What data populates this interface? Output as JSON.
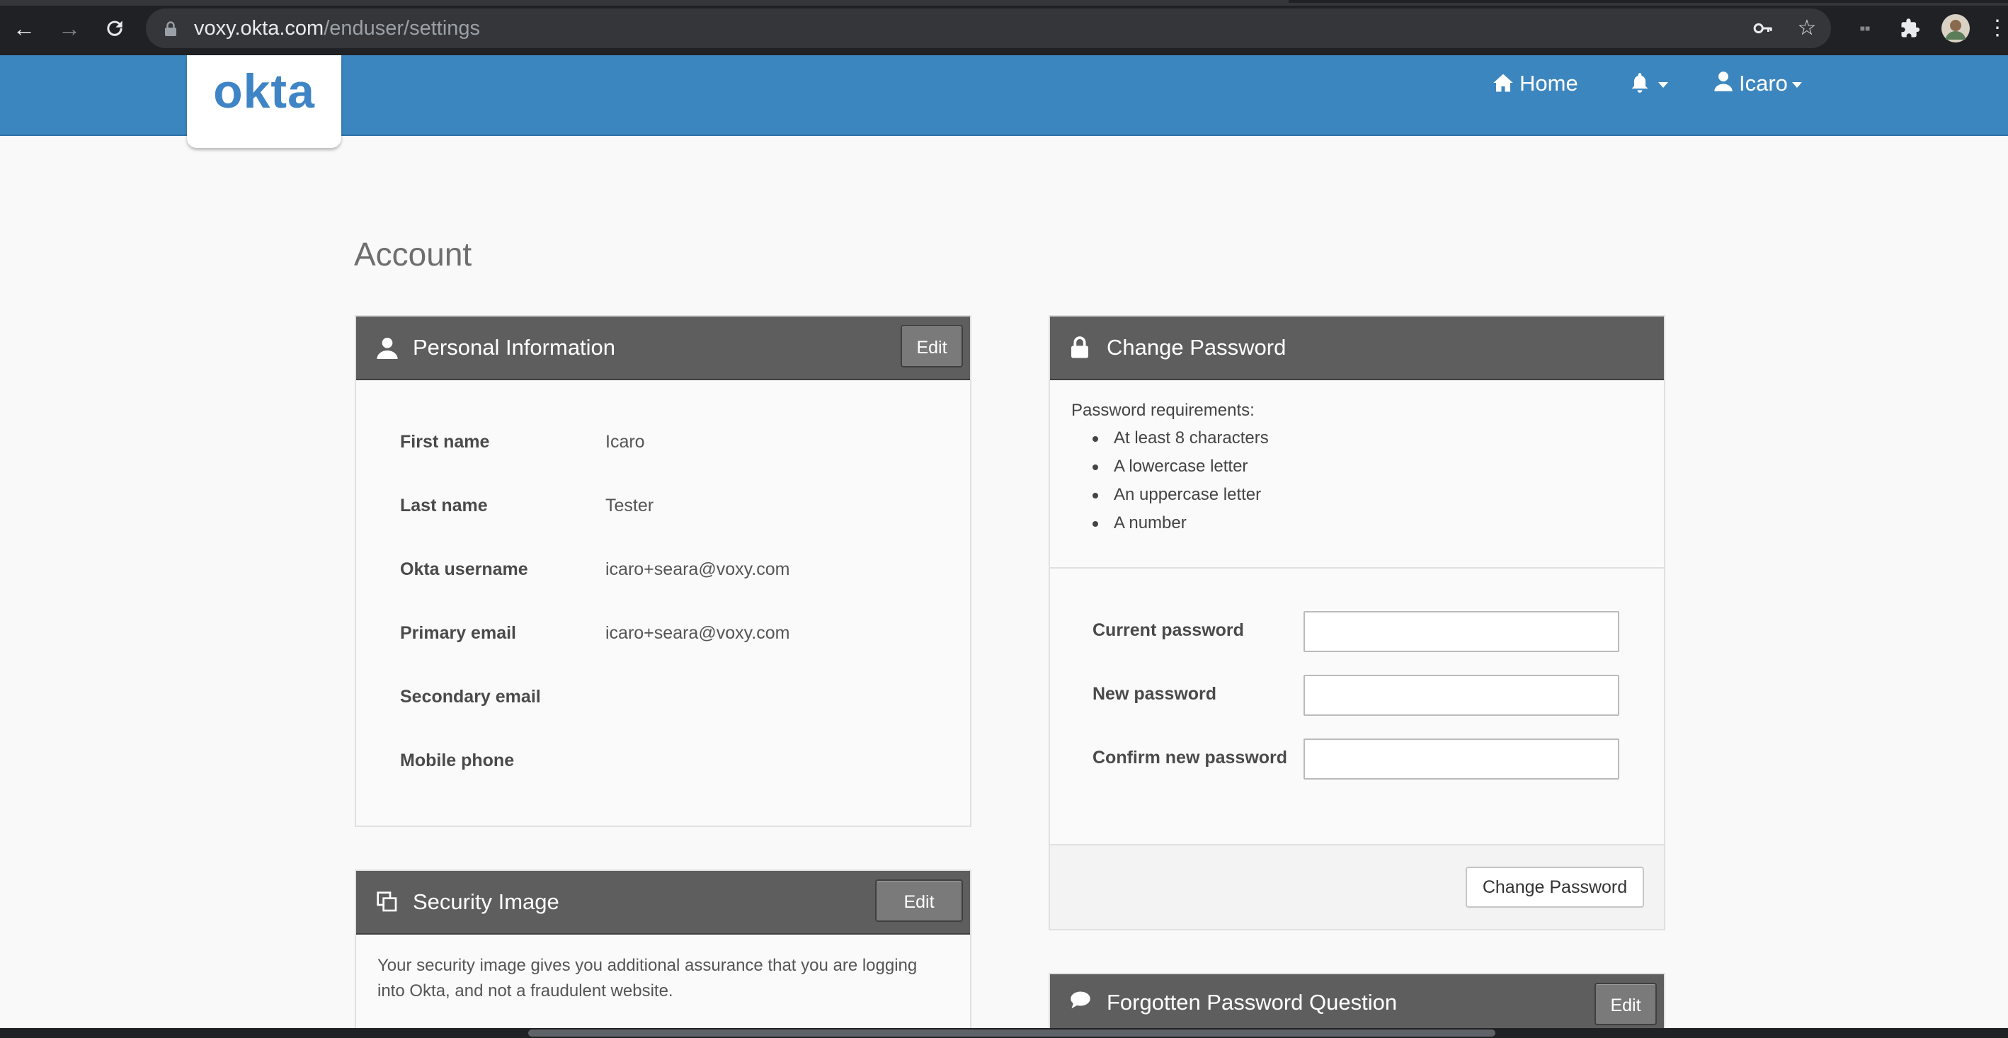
{
  "browser": {
    "url_domain": "voxy.okta.com",
    "url_path": "/enduser/settings"
  },
  "header": {
    "logo_text": "okta",
    "home_label": "Home",
    "user_label": "Icaro",
    "brand_color": "#3c86bf"
  },
  "page": {
    "title": "Account"
  },
  "personal_info": {
    "title": "Personal Information",
    "edit_label": "Edit",
    "fields": [
      {
        "label": "First name",
        "value": "Icaro"
      },
      {
        "label": "Last name",
        "value": "Tester"
      },
      {
        "label": "Okta username",
        "value": "icaro+seara@voxy.com"
      },
      {
        "label": "Primary email",
        "value": "icaro+seara@voxy.com"
      },
      {
        "label": "Secondary email",
        "value": ""
      },
      {
        "label": "Mobile phone",
        "value": ""
      }
    ]
  },
  "security_image": {
    "title": "Security Image",
    "edit_label": "Edit",
    "description": "Your security image gives you additional assurance that you are logging into Okta, and not a fraudulent website."
  },
  "change_password": {
    "title": "Change Password",
    "requirements_label": "Password requirements:",
    "requirements": [
      "At least 8 characters",
      "A lowercase letter",
      "An uppercase letter",
      "A number"
    ],
    "fields": [
      {
        "label": "Current password",
        "value": ""
      },
      {
        "label": "New password",
        "value": ""
      },
      {
        "label": "Confirm new password",
        "value": ""
      }
    ],
    "submit_label": "Change Password"
  },
  "forgotten_question": {
    "title": "Forgotten Password Question",
    "edit_label": "Edit"
  }
}
